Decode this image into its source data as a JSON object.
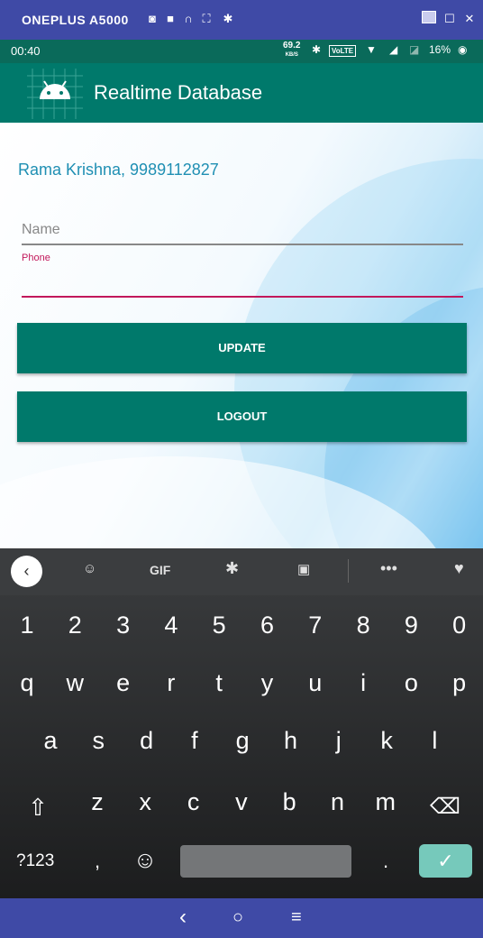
{
  "window": {
    "device_name": "ONEPLUS A5000",
    "icons": [
      "camera-icon",
      "video-icon",
      "headphones-icon",
      "fullscreen-icon",
      "settings-icon",
      "minimize-icon",
      "maximize-icon",
      "close-icon"
    ]
  },
  "status_bar": {
    "time": "00:40",
    "net_speed": "69.2",
    "net_unit": "KB/S",
    "volte": "VoLTE",
    "battery": "16%"
  },
  "app_bar": {
    "title": "Realtime Database"
  },
  "main": {
    "user_info": "Rama Krishna, 9989112827",
    "name_placeholder": "Name",
    "phone_label": "Phone",
    "phone_value": "",
    "update_label": "UPDATE",
    "logout_label": "LOGOUT"
  },
  "keyboard": {
    "toolbar": {
      "gif": "GIF"
    },
    "row_numbers": [
      "1",
      "2",
      "3",
      "4",
      "5",
      "6",
      "7",
      "8",
      "9",
      "0"
    ],
    "row_q": [
      "q",
      "w",
      "e",
      "r",
      "t",
      "y",
      "u",
      "i",
      "o",
      "p"
    ],
    "row_a": [
      "a",
      "s",
      "d",
      "f",
      "g",
      "h",
      "j",
      "k",
      "l"
    ],
    "row_z": [
      "z",
      "x",
      "c",
      "v",
      "b",
      "n",
      "m"
    ],
    "symbols_key": "?123",
    "comma": ",",
    "period": "."
  },
  "colors": {
    "primary": "#00796b",
    "accent": "#c2185b",
    "window_bar": "#3f4aa6",
    "text_link": "#1f8fb3"
  }
}
